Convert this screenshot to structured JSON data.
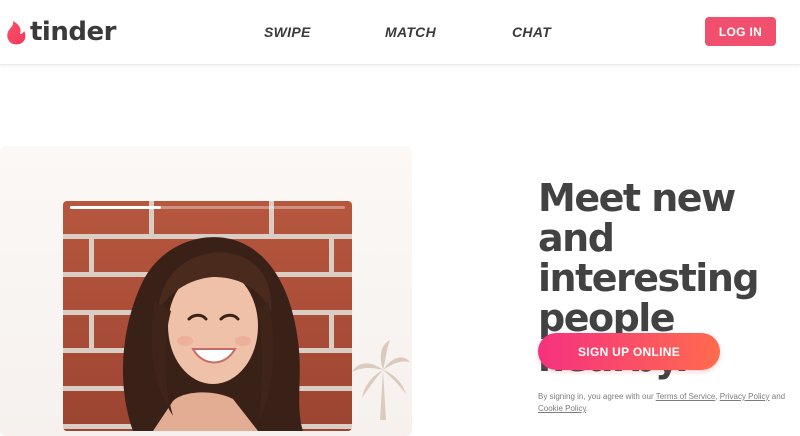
{
  "brand": {
    "name": "tinder",
    "accent": "#fd5068",
    "gradient_start": "#f5317f",
    "gradient_end": "#ff6b4e"
  },
  "nav": {
    "items": [
      {
        "label": "SWIPE"
      },
      {
        "label": "MATCH"
      },
      {
        "label": "CHAT"
      }
    ],
    "login_label": "LOG IN"
  },
  "hero": {
    "headline_lines": [
      "Meet new and",
      "interesting",
      "people nearby."
    ],
    "signup_label": "SIGN UP ONLINE",
    "story_progress": 0.33,
    "legal": {
      "prefix": "By signing in, you agree with our ",
      "terms": "Terms of Service",
      "sep1": ", ",
      "privacy": "Privacy Policy",
      "sep2": " and ",
      "cookie": "Cookie Policy",
      "suffix": "."
    }
  }
}
